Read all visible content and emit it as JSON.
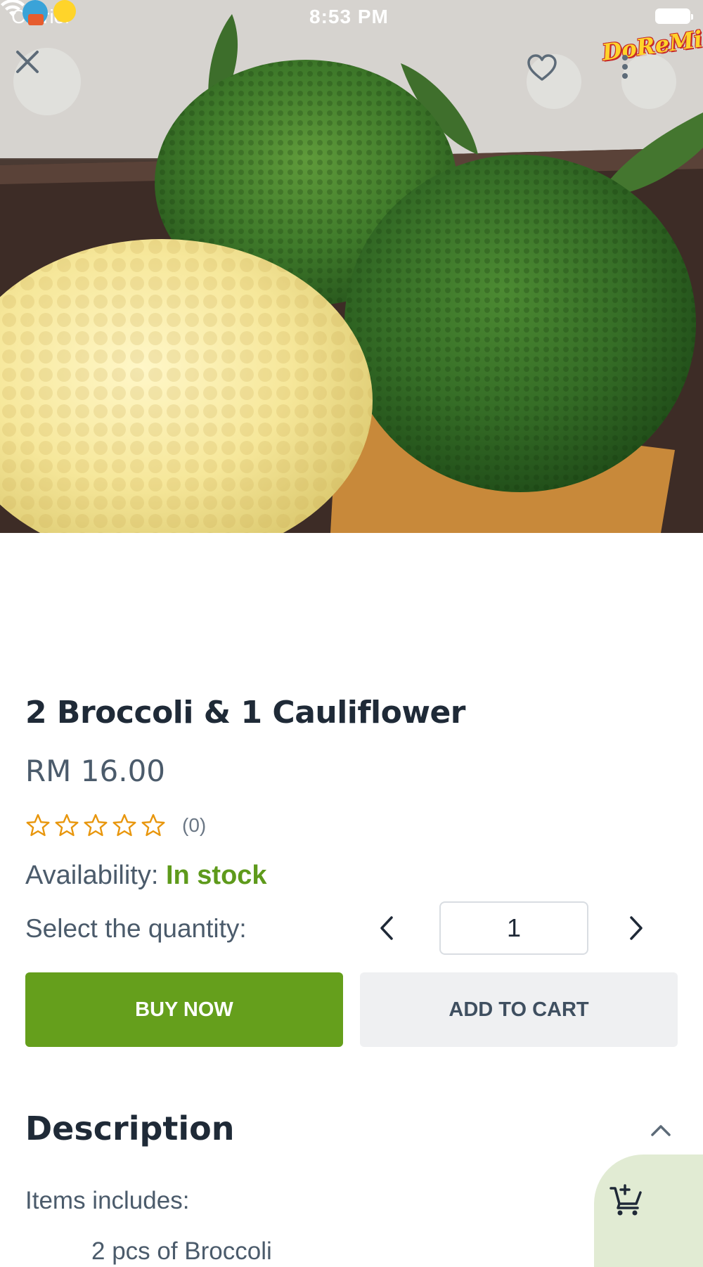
{
  "status_bar": {
    "carrier": "Carrier",
    "time": "8:53 PM"
  },
  "brand": {
    "logo_text": "DoReMi"
  },
  "hero": {
    "icons": [
      "close-icon",
      "heart-icon",
      "more-vertical-icon"
    ]
  },
  "product": {
    "title": "2 Broccoli & 1 Cauliflower",
    "price": "RM 16.00",
    "rating": {
      "stars_filled": 0,
      "stars_total": 5,
      "count_label": "(0)"
    },
    "availability_label": "Availability:",
    "availability_value": "In stock",
    "quantity_label": "Select the quantity:",
    "quantity_value": "1"
  },
  "actions": {
    "buy_now": "BUY NOW",
    "add_to_cart": "ADD TO CART"
  },
  "description": {
    "title": "Description",
    "intro": "Items includes:",
    "first_item": "2 pcs of Broccoli"
  },
  "colors": {
    "accent_green": "#659f1c",
    "in_stock_green": "#5e9a1b",
    "star_orange": "#e8960c",
    "floating_cart_bg": "#e1ebd3"
  }
}
